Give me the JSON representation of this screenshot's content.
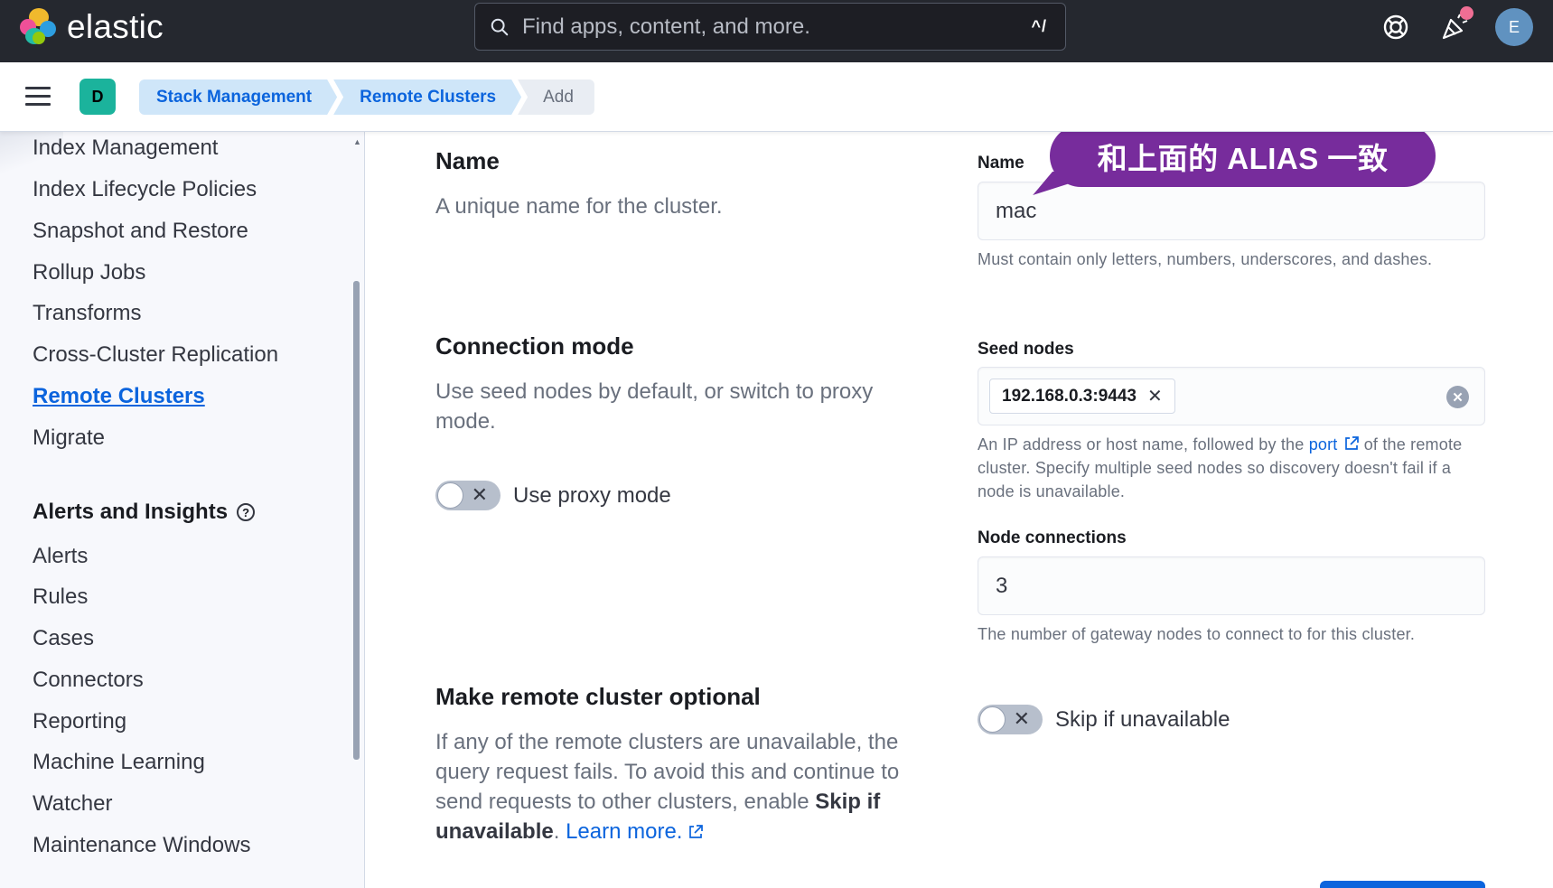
{
  "header": {
    "logo_text": "elastic",
    "search_placeholder": "Find apps, content, and more.",
    "search_shortcut": "^/",
    "avatar_initial": "E"
  },
  "breadcrumb_bar": {
    "space_initial": "D",
    "crumbs": [
      "Stack Management",
      "Remote Clusters",
      "Add"
    ]
  },
  "sidebar": {
    "items_top": [
      "Index Management",
      "Index Lifecycle Policies",
      "Snapshot and Restore",
      "Rollup Jobs",
      "Transforms",
      "Cross-Cluster Replication",
      "Remote Clusters",
      "Migrate"
    ],
    "active_item": "Remote Clusters",
    "section_heading": "Alerts and Insights",
    "items_bottom": [
      "Alerts",
      "Rules",
      "Cases",
      "Connectors",
      "Reporting",
      "Machine Learning",
      "Watcher",
      "Maintenance Windows"
    ]
  },
  "form": {
    "name_section": {
      "title": "Name",
      "description": "A unique name for the cluster.",
      "field_label": "Name",
      "field_value": "mac",
      "help": "Must contain only letters, numbers, underscores, and dashes."
    },
    "connection_section": {
      "title": "Connection mode",
      "description": "Use seed nodes by default, or switch to proxy mode.",
      "toggle_label": "Use proxy mode",
      "seed_label": "Seed nodes",
      "seed_value": "192.168.0.3:9443",
      "seed_help_before": "An IP address or host name, followed by the",
      "seed_help_link": "port",
      "seed_help_after": "of the remote cluster. Specify multiple seed nodes so discovery doesn't fail if a node is unavailable.",
      "node_conn_label": "Node connections",
      "node_conn_value": "3",
      "node_conn_help": "The number of gateway nodes to connect to for this cluster."
    },
    "optional_section": {
      "title": "Make remote cluster optional",
      "desc_part1": "If any of the remote clusters are unavailable, the query request fails. To avoid this and continue to send requests to other clusters, enable",
      "desc_bold": "Skip if unavailable",
      "desc_part2": ".",
      "learn_more": "Learn more.",
      "toggle_label": "Skip if unavailable"
    }
  },
  "annotation": {
    "text": "和上面的 ALIAS 一致"
  },
  "colors": {
    "header_bg": "#25282f",
    "accent": "#0b64dd",
    "callout": "#772c9c",
    "space_badge": "#1bb39c"
  }
}
